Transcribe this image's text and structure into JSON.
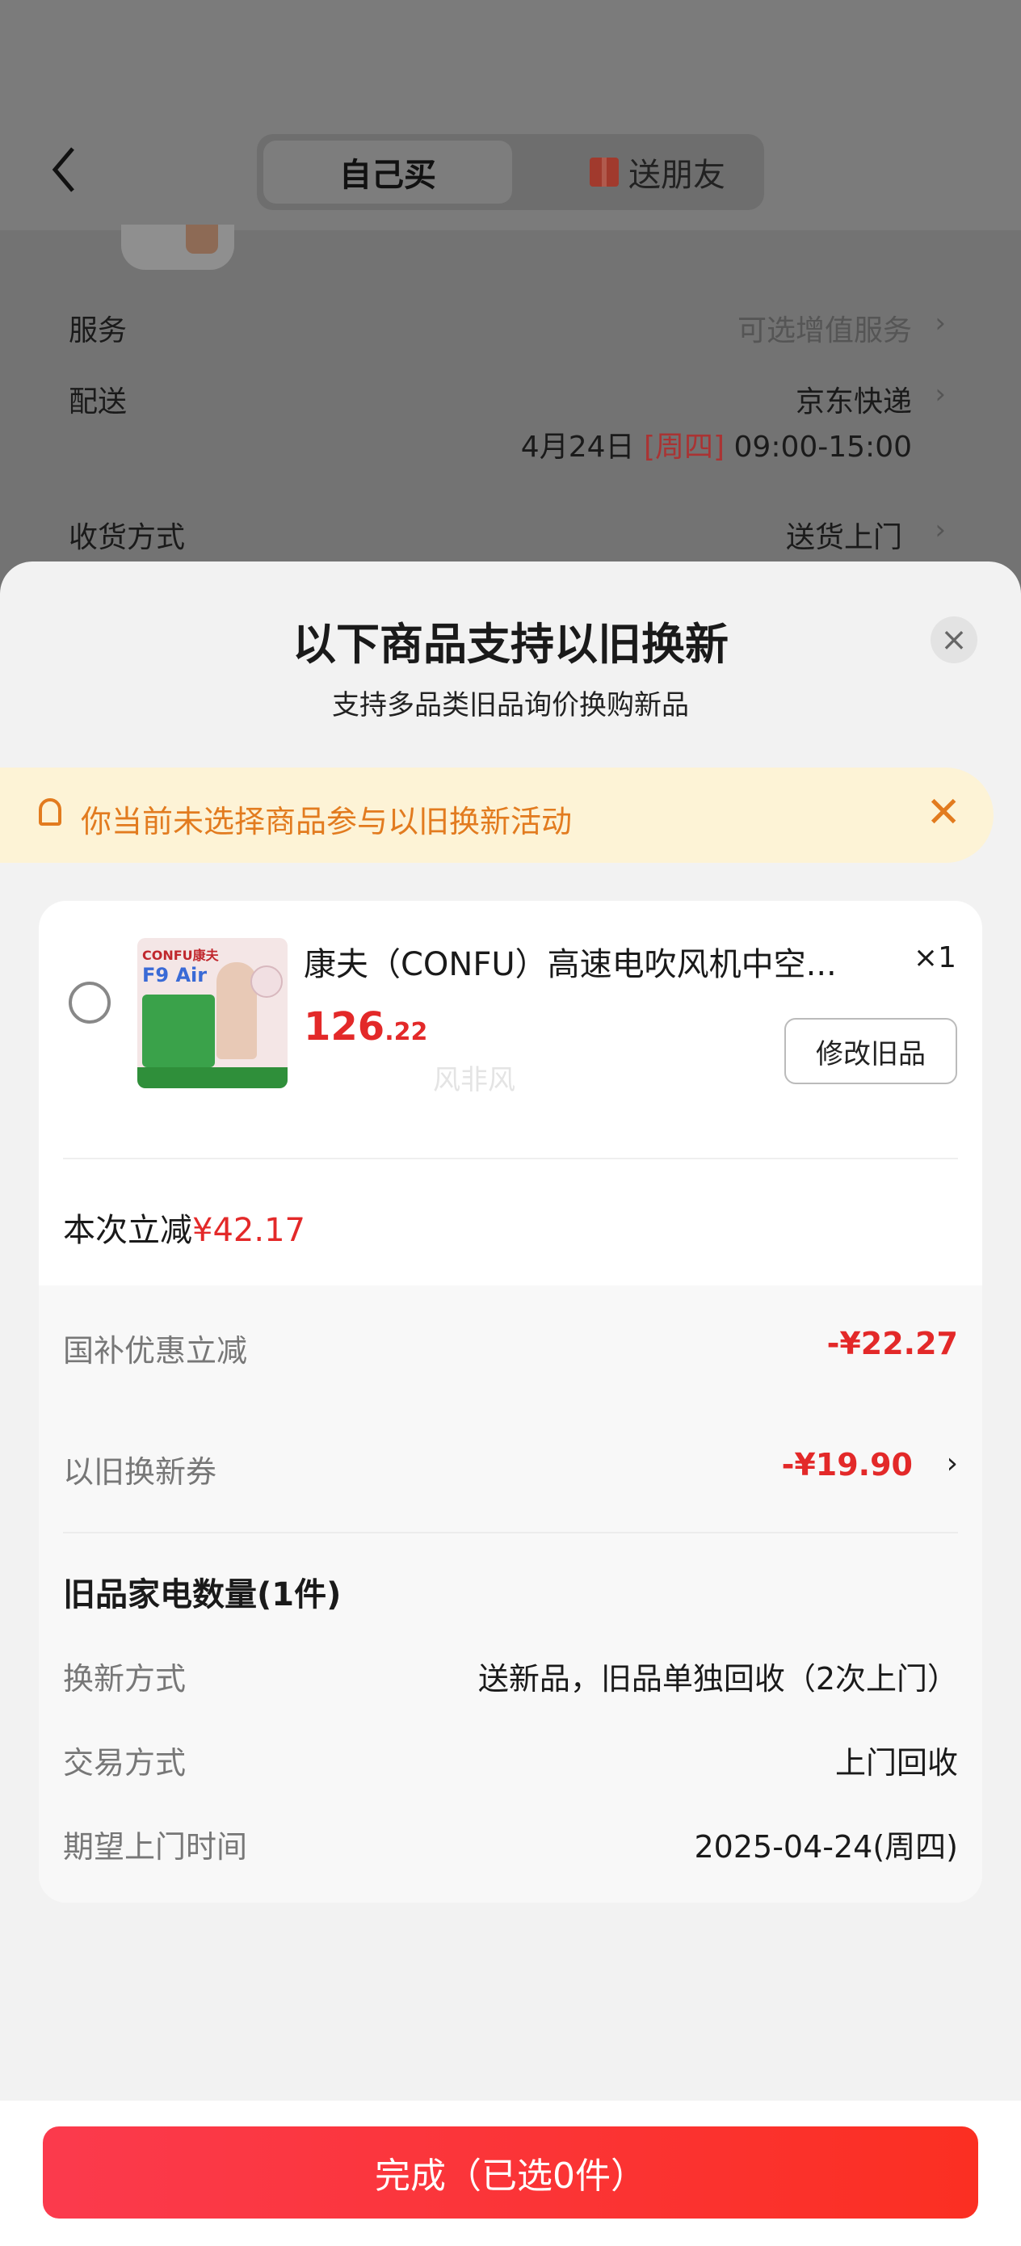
{
  "header": {
    "tabs": [
      {
        "label": "自己买",
        "active": true
      },
      {
        "label": "送朋友",
        "active": false
      }
    ]
  },
  "background_order": {
    "rows": [
      {
        "label": "服务",
        "value": "可选增值服务"
      },
      {
        "label": "配送",
        "value": "京东快递",
        "date": "4月24日",
        "weekday": "[周四]",
        "time": "09:00-15:00"
      },
      {
        "label": "收货方式",
        "value": "送货上门"
      }
    ]
  },
  "sheet": {
    "title": "以下商品支持以旧换新",
    "subtitle": "支持多品类旧品询价换购新品",
    "notice": "你当前未选择商品参与以旧换新活动",
    "product": {
      "thumb_brand": "CONFU康夫",
      "thumb_model": "F9 Air",
      "name": "康夫（CONFU）高速电吹风机中空...",
      "quantity": "×1",
      "price_int": "126",
      "price_dec": ".22",
      "edit_label": "修改旧品",
      "watermark": "风非风"
    },
    "saving_label": "本次立减",
    "saving_value": "¥42.17",
    "discounts": [
      {
        "label": "国补优惠立减",
        "value": "-¥22.27"
      },
      {
        "label": "以旧换新券",
        "value": "-¥19.90"
      }
    ],
    "old_title": "旧品家电数量(1件)",
    "details": [
      {
        "label": "换新方式",
        "value": "送新品，旧品单独回收（2次上门）"
      },
      {
        "label": "交易方式",
        "value": "上门回收"
      },
      {
        "label": "期望上门时间",
        "value": "2025-04-24(周四)"
      }
    ],
    "done_label": "完成（已选0件）"
  },
  "colors": {
    "accent_red": "#e32929",
    "notice_orange": "#e27b1f",
    "notice_bg": "#fdf3d6"
  }
}
